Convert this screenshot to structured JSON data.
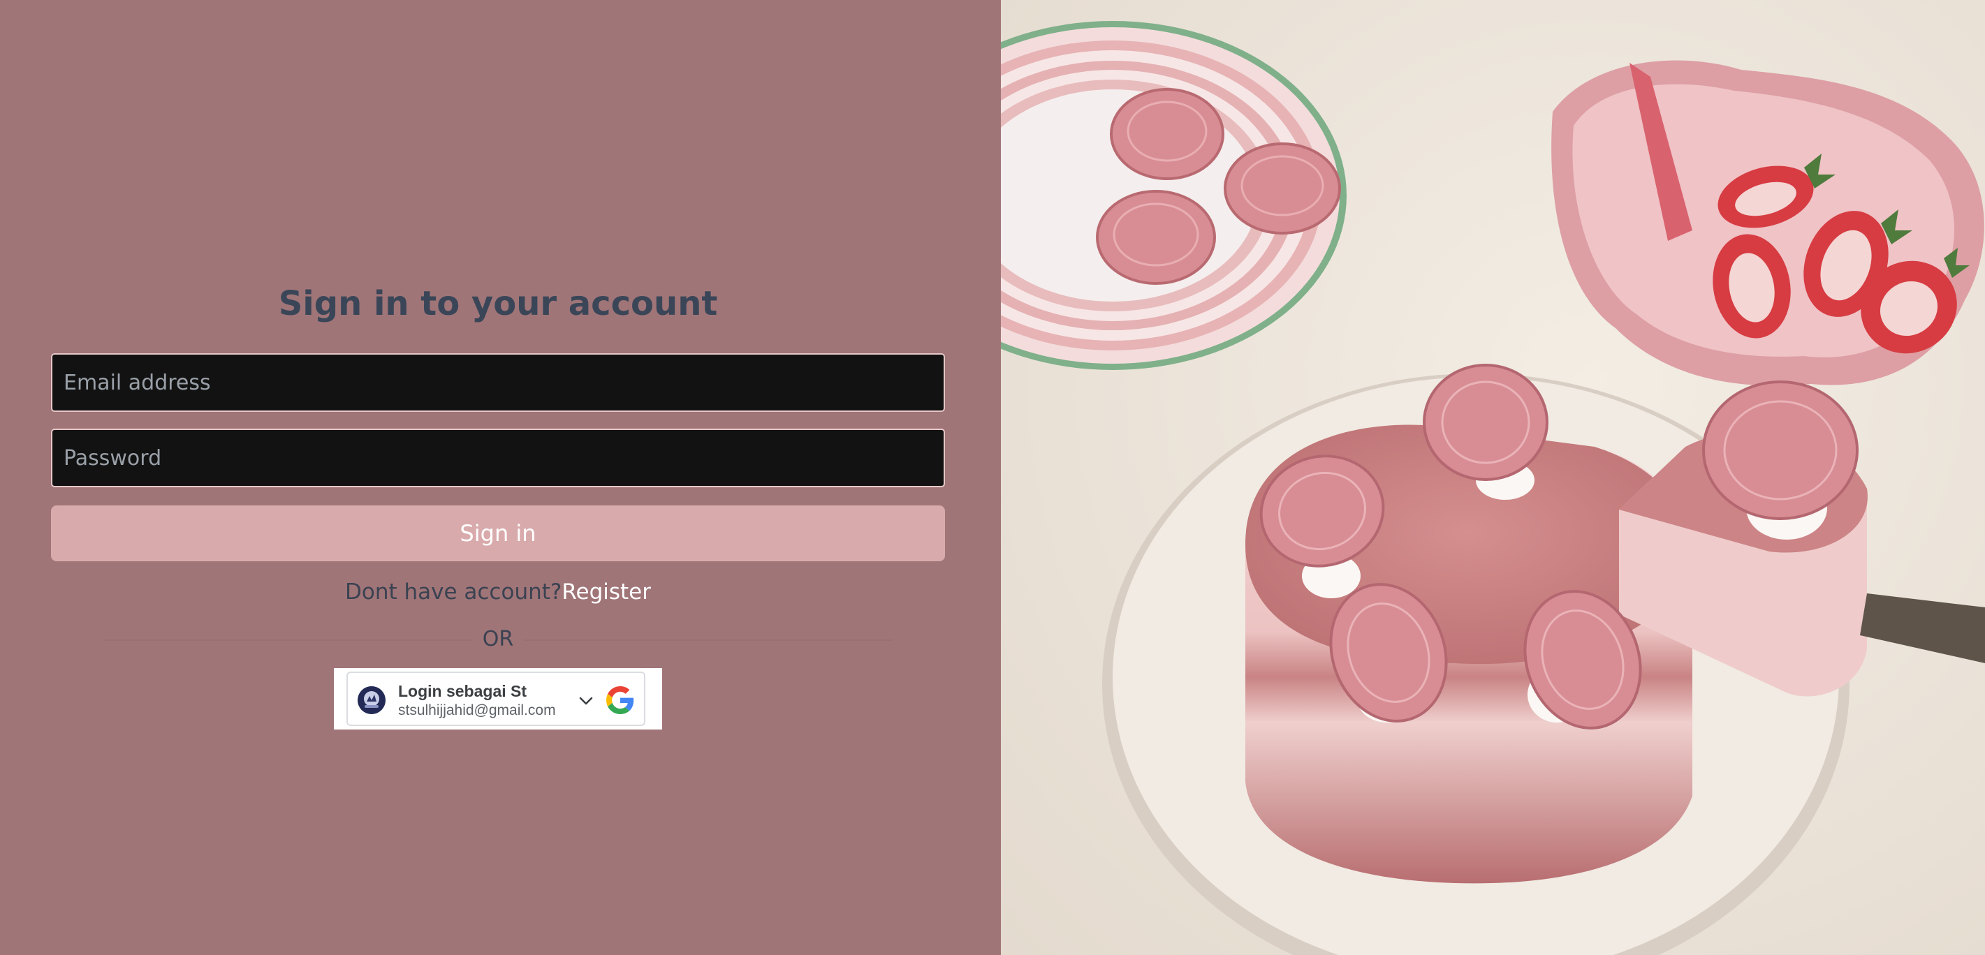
{
  "login": {
    "heading": "Sign in to your account",
    "email_placeholder": "Email address",
    "password_placeholder": "Password",
    "signin_label": "Sign in",
    "no_account_text": "Dont have account?",
    "register_label": "Register",
    "or_label": "OR"
  },
  "google_signin": {
    "name_label": "Login sebagai St",
    "email": "stsulhijjahid@gmail.com",
    "icon": "google-g-icon"
  },
  "hero_image": {
    "subject": "pink strawberry cake with pink cookies and strawberries",
    "icon": "cake-photo"
  },
  "colors": {
    "left_background": "#a07578",
    "heading": "#3a4658",
    "input_background": "#121212",
    "button_background": "#d9aaab",
    "photo_background": "#ede6dc"
  }
}
